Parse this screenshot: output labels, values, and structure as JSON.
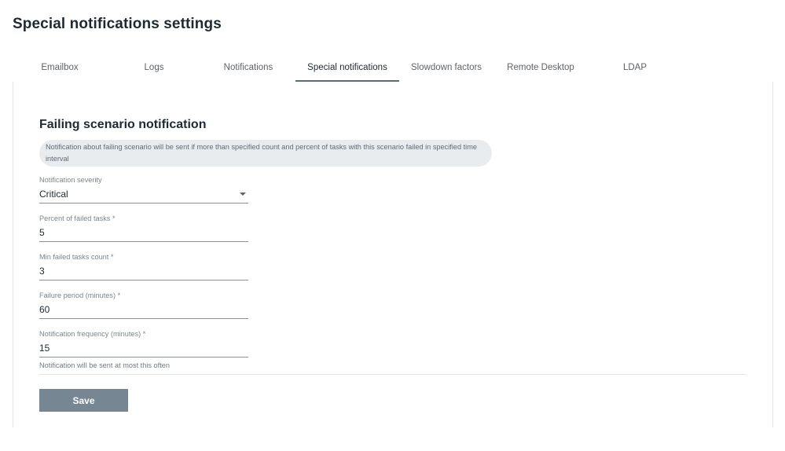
{
  "page": {
    "title": "Special notifications settings"
  },
  "tabs": [
    {
      "label": "Emailbox"
    },
    {
      "label": "Logs"
    },
    {
      "label": "Notifications"
    },
    {
      "label": "Special notifications"
    },
    {
      "label": "Slowdown factors"
    },
    {
      "label": "Remote Desktop"
    },
    {
      "label": "LDAP"
    }
  ],
  "active_tab": "Special notifications",
  "section": {
    "title": "Failing scenario notification",
    "info": "Notification about failing scenario will be sent if more than specified count and percent of tasks with this scenario failed in specified time interval"
  },
  "form": {
    "severity": {
      "label": "Notification severity",
      "value": "Critical"
    },
    "percent_failed": {
      "label": "Percent of failed tasks *",
      "value": "5"
    },
    "min_failed": {
      "label": "Min failed tasks count *",
      "value": "3"
    },
    "failure_period": {
      "label": "Failure period (minutes) *",
      "value": "60"
    },
    "frequency": {
      "label": "Notification frequency (minutes) *",
      "value": "15",
      "hint": "Notification will be sent at most this often"
    }
  },
  "save_label": "Save",
  "colors": {
    "accent": "#5b6a7a",
    "button": "#768693",
    "info_bg": "#e9ecee"
  }
}
